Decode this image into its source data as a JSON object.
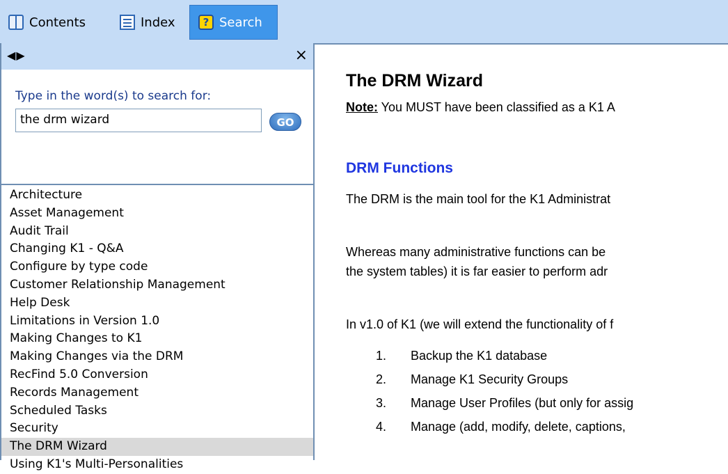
{
  "tabs": [
    {
      "label": "Contents",
      "icon": "book-icon"
    },
    {
      "label": "Index",
      "icon": "list-icon"
    },
    {
      "label": "Search",
      "icon": "help-icon",
      "selected": true
    }
  ],
  "nav": {
    "back_icon": "◀",
    "forward_icon": "▶",
    "close_icon": "×"
  },
  "search": {
    "prompt": "Type in the word(s) to search for:",
    "query": "the drm wizard",
    "go_label": "GO"
  },
  "results": [
    "Architecture",
    "Asset Management",
    "Audit Trail",
    "Changing K1 - Q&A",
    "Configure by type code",
    "Customer Relationship Management",
    "Help Desk",
    "Limitations in Version 1.0",
    "Making Changes to K1",
    "Making Changes via the DRM",
    "RecFind 5.0 Conversion",
    "Records Management",
    "Scheduled Tasks",
    "Security",
    "The DRM Wizard",
    "Using K1's Multi-Personalities"
  ],
  "selected_result": "The DRM Wizard",
  "content": {
    "title": "The DRM Wizard",
    "note_label": "Note:",
    "note_text": " You MUST have been classified as a K1 A",
    "subheading": "DRM Functions",
    "para1": "The DRM is the main tool for the K1 Administrat",
    "para2_line1": "Whereas many administrative functions can be",
    "para2_line2": "the system tables) it is far easier to perform adr",
    "para3": "In v1.0 of K1 (we will extend the functionality of f",
    "steps": [
      {
        "num": "1.",
        "text": "Backup the K1 database"
      },
      {
        "num": "2.",
        "text": "Manage K1 Security Groups"
      },
      {
        "num": "3.",
        "text": "Manage User Profiles (but only for assig"
      },
      {
        "num": "4.",
        "text": "Manage (add, modify, delete, captions,"
      }
    ]
  },
  "colors": {
    "toolbar_bg": "#c5dcf6",
    "selected_tab": "#3f96ea",
    "subheading": "#1f36e0",
    "prompt_text": "#1a3a8c"
  }
}
